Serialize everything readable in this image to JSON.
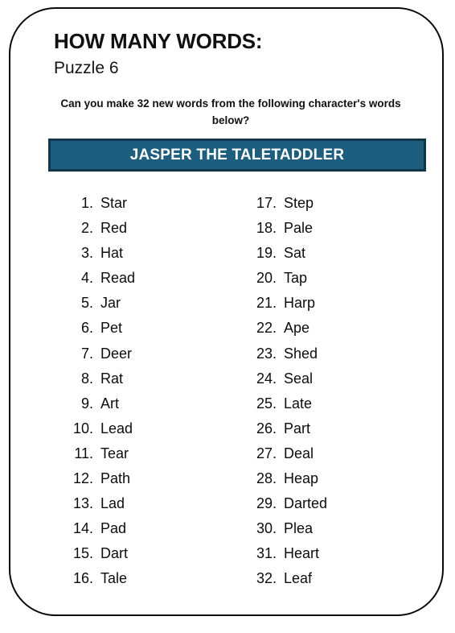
{
  "worksheet": {
    "title": "HOW MANY WORDS:",
    "puzzle_label": "Puzzle 6",
    "instructions": "Can you make 32 new words from the following character's words below?",
    "character_banner": {
      "label": "JASPER THE TALETADDLER",
      "background_color": "#1d5d7e",
      "border_color": "#10364a",
      "text_color": "#ffffff"
    },
    "target_word_count": 32,
    "columns": [
      {
        "name": "left-column",
        "items": [
          {
            "index": "1.",
            "word": "Star"
          },
          {
            "index": "2.",
            "word": "Red"
          },
          {
            "index": "3.",
            "word": "Hat"
          },
          {
            "index": "4.",
            "word": "Read"
          },
          {
            "index": "5.",
            "word": "Jar"
          },
          {
            "index": "6.",
            "word": "Pet"
          },
          {
            "index": "7.",
            "word": "Deer"
          },
          {
            "index": "8.",
            "word": "Rat"
          },
          {
            "index": "9.",
            "word": "Art"
          },
          {
            "index": "10.",
            "word": "Lead"
          },
          {
            "index": "11.",
            "word": "Tear"
          },
          {
            "index": "12.",
            "word": "Path"
          },
          {
            "index": "13.",
            "word": "Lad"
          },
          {
            "index": "14.",
            "word": "Pad"
          },
          {
            "index": "15.",
            "word": "Dart"
          },
          {
            "index": "16.",
            "word": "Tale"
          }
        ]
      },
      {
        "name": "right-column",
        "items": [
          {
            "index": "17.",
            "word": "Step"
          },
          {
            "index": "18.",
            "word": "Pale"
          },
          {
            "index": "19.",
            "word": "Sat"
          },
          {
            "index": "20.",
            "word": "Tap"
          },
          {
            "index": "21.",
            "word": "Harp"
          },
          {
            "index": "22.",
            "word": "Ape"
          },
          {
            "index": "23.",
            "word": "Shed"
          },
          {
            "index": "24.",
            "word": "Seal"
          },
          {
            "index": "25.",
            "word": "Late"
          },
          {
            "index": "26.",
            "word": "Part"
          },
          {
            "index": "27.",
            "word": "Deal"
          },
          {
            "index": "28.",
            "word": "Heap"
          },
          {
            "index": "29.",
            "word": "Darted"
          },
          {
            "index": "30.",
            "word": "Plea"
          },
          {
            "index": "31.",
            "word": "Heart"
          },
          {
            "index": "32.",
            "word": "Leaf"
          }
        ]
      }
    ]
  }
}
